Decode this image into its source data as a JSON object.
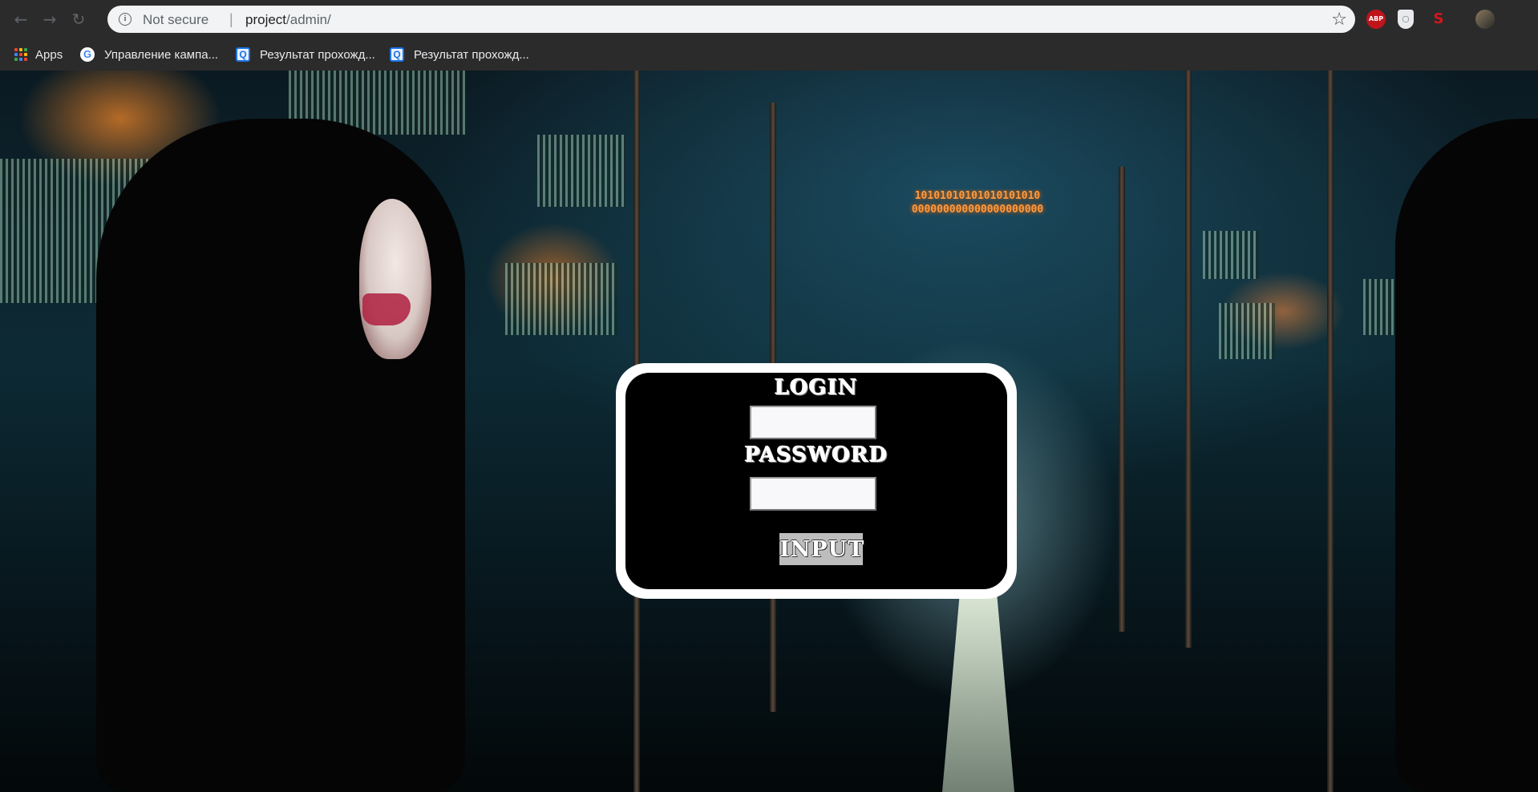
{
  "browser": {
    "security_label": "Not secure",
    "separator": "|",
    "url_host": "project",
    "url_path": "/admin/",
    "extensions": {
      "abp": "ABP",
      "seo": "S"
    }
  },
  "bookmarks": [
    {
      "label": "Apps",
      "icon": "apps-grid-icon"
    },
    {
      "label": "Управление кампа...",
      "icon": "google-icon"
    },
    {
      "label": "Результат прохожд...",
      "icon": "quiz-icon"
    },
    {
      "label": "Результат прохожд...",
      "icon": "quiz-icon"
    }
  ],
  "led_sign": "10101010101010101010\n000000000000000000000",
  "login_form": {
    "login_label": "LOGIN",
    "login_value": "",
    "password_label": "PASSWORD",
    "password_value": "",
    "submit_label": "INPUT"
  },
  "colors": {
    "card_border": "#ffffff",
    "card_background": "#000000",
    "button_background": "#bdbdbd"
  }
}
